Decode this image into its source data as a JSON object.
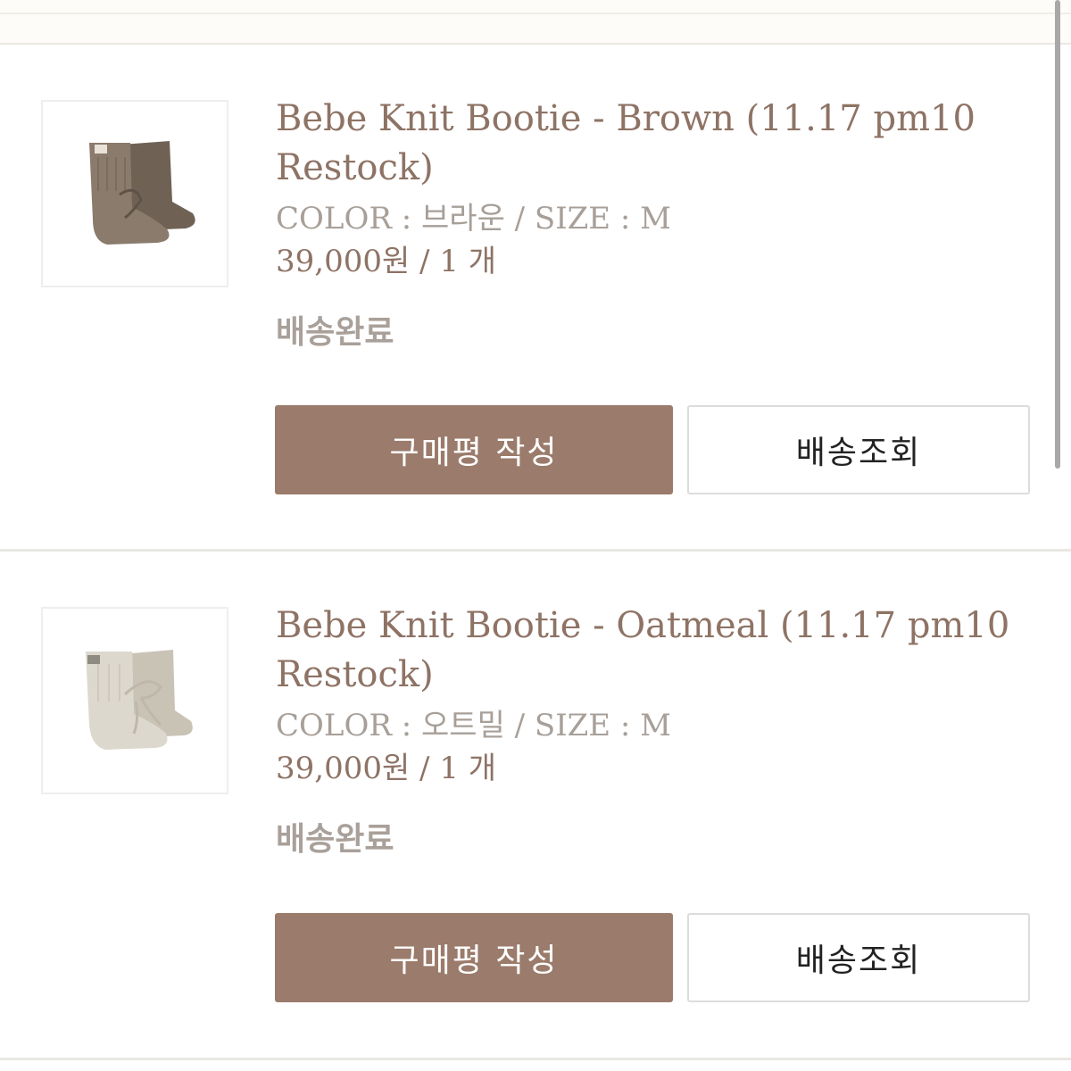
{
  "items": [
    {
      "name": "Bebe Knit Bootie - Brown (11.17 pm10 Restock)",
      "option": "COLOR : 브라운 / SIZE : M",
      "price": "39,000원 / 1 개",
      "status": "배송완료",
      "review_button": "구매평 작성",
      "track_button": "배송조회",
      "bootie_color": "#8a7b6c",
      "bootie_shade": "#6f6255"
    },
    {
      "name": "Bebe Knit Bootie - Oatmeal (11.17 pm10 Restock)",
      "option": "COLOR : 오트밀 / SIZE : M",
      "price": "39,000원 / 1 개",
      "status": "배송완료",
      "review_button": "구매평 작성",
      "track_button": "배송조회",
      "bootie_color": "#ddd8cd",
      "bootie_shade": "#c9c3b6"
    }
  ],
  "colors": {
    "accent": "#9b7b6b",
    "title_text": "#8e7365",
    "muted_text": "#a79f98"
  }
}
